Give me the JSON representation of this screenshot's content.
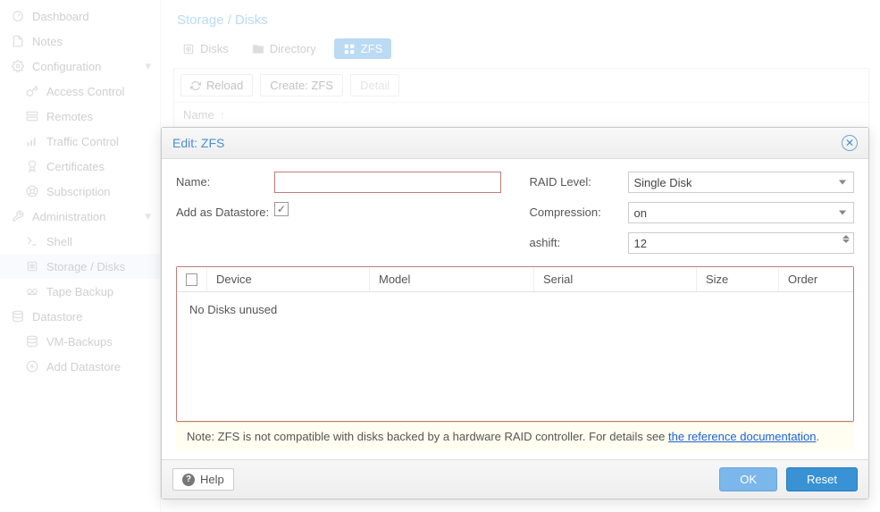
{
  "sidebar": {
    "items": [
      {
        "label": "Dashboard",
        "icon": "gauge"
      },
      {
        "label": "Notes",
        "icon": "file"
      },
      {
        "label": "Configuration",
        "icon": "cogs",
        "expand": true
      },
      {
        "label": "Access Control",
        "icon": "key",
        "child": true
      },
      {
        "label": "Remotes",
        "icon": "server",
        "child": true
      },
      {
        "label": "Traffic Control",
        "icon": "signal",
        "child": true
      },
      {
        "label": "Certificates",
        "icon": "cert",
        "child": true
      },
      {
        "label": "Subscription",
        "icon": "support",
        "child": true
      },
      {
        "label": "Administration",
        "icon": "wrench",
        "expand": true
      },
      {
        "label": "Shell",
        "icon": "terminal",
        "child": true
      },
      {
        "label": "Storage / Disks",
        "icon": "hdd",
        "child": true,
        "selected": true
      },
      {
        "label": "Tape Backup",
        "icon": "tape",
        "child": true
      },
      {
        "label": "Datastore",
        "icon": "db"
      },
      {
        "label": "VM-Backups",
        "icon": "db",
        "child": true
      },
      {
        "label": "Add Datastore",
        "icon": "plus",
        "child": true
      }
    ]
  },
  "breadcrumb": "Storage / Disks",
  "tabs": [
    {
      "label": "Disks",
      "icon": "hdd"
    },
    {
      "label": "Directory",
      "icon": "folder"
    },
    {
      "label": "ZFS",
      "icon": "th",
      "active": true
    }
  ],
  "toolbar": {
    "reload": "Reload",
    "create": "Create: ZFS",
    "detail": "Detail"
  },
  "grid": {
    "name_col": "Name"
  },
  "modal": {
    "title": "Edit: ZFS",
    "labels": {
      "name": "Name:",
      "add_as": "Add as Datastore:",
      "raid": "RAID Level:",
      "compression": "Compression:",
      "ashift": "ashift:"
    },
    "values": {
      "name": "",
      "raid": "Single Disk",
      "compression": "on",
      "ashift": "12",
      "add_as_checked": true
    },
    "diskcols": {
      "device": "Device",
      "model": "Model",
      "serial": "Serial",
      "size": "Size",
      "order": "Order"
    },
    "empty": "No Disks unused",
    "note_prefix": "Note: ZFS is not compatible with disks backed by a hardware RAID controller. For details see ",
    "note_link": "the reference documentation",
    "note_suffix": ".",
    "help": "Help",
    "ok": "OK",
    "reset": "Reset"
  }
}
